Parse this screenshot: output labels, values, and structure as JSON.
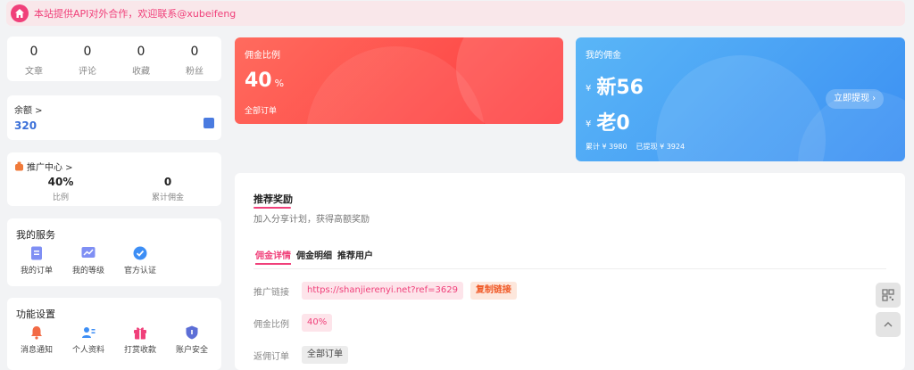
{
  "notice": {
    "text": "本站提供API对外合作，欢迎联系@xubeifeng"
  },
  "stats": [
    {
      "value": "0",
      "label": "文章"
    },
    {
      "value": "0",
      "label": "评论"
    },
    {
      "value": "0",
      "label": "收藏"
    },
    {
      "value": "0",
      "label": "粉丝"
    }
  ],
  "balance": {
    "title": "余额 >",
    "value": "320"
  },
  "promo": {
    "title": "推广中心 >",
    "rate_value": "40%",
    "rate_label": "比例",
    "total_value": "0",
    "total_label": "累计佣金"
  },
  "services": {
    "heading": "我的服务",
    "items": [
      {
        "label": "我的订单"
      },
      {
        "label": "我的等级"
      },
      {
        "label": "官方认证"
      }
    ]
  },
  "functions": {
    "heading": "功能设置",
    "items": [
      {
        "label": "消息通知"
      },
      {
        "label": "个人资料"
      },
      {
        "label": "打赏收款"
      },
      {
        "label": "账户安全"
      }
    ]
  },
  "commission_rate_card": {
    "label": "佣金比例",
    "value": "40",
    "unit": "%",
    "sub": "全部订单"
  },
  "my_commission_card": {
    "label": "我的佣金",
    "currency": "¥",
    "new_value": "新56",
    "old_value": "老0",
    "total": "累计 ¥ 3980",
    "withdrawn": "已提现 ¥ 3924",
    "withdraw_button": "立即提现 ›"
  },
  "referral": {
    "title": "推荐奖励",
    "desc": "加入分享计划，获得高额奖励",
    "tabs": [
      {
        "label": "佣金详情"
      },
      {
        "label": "佣金明细"
      },
      {
        "label": "推荐用户"
      }
    ],
    "link_label": "推广链接",
    "link_value": "https://shanjierenyi.net?ref=3629",
    "copy_button": "复制链接",
    "rate_label": "佣金比例",
    "rate_value": "40%",
    "orders_label": "返佣订单",
    "orders_value": "全部订单"
  },
  "colors": {
    "accent_pink": "#f0407a",
    "red_card": "#fe3b3e",
    "blue_card": "#3b8ff2"
  }
}
